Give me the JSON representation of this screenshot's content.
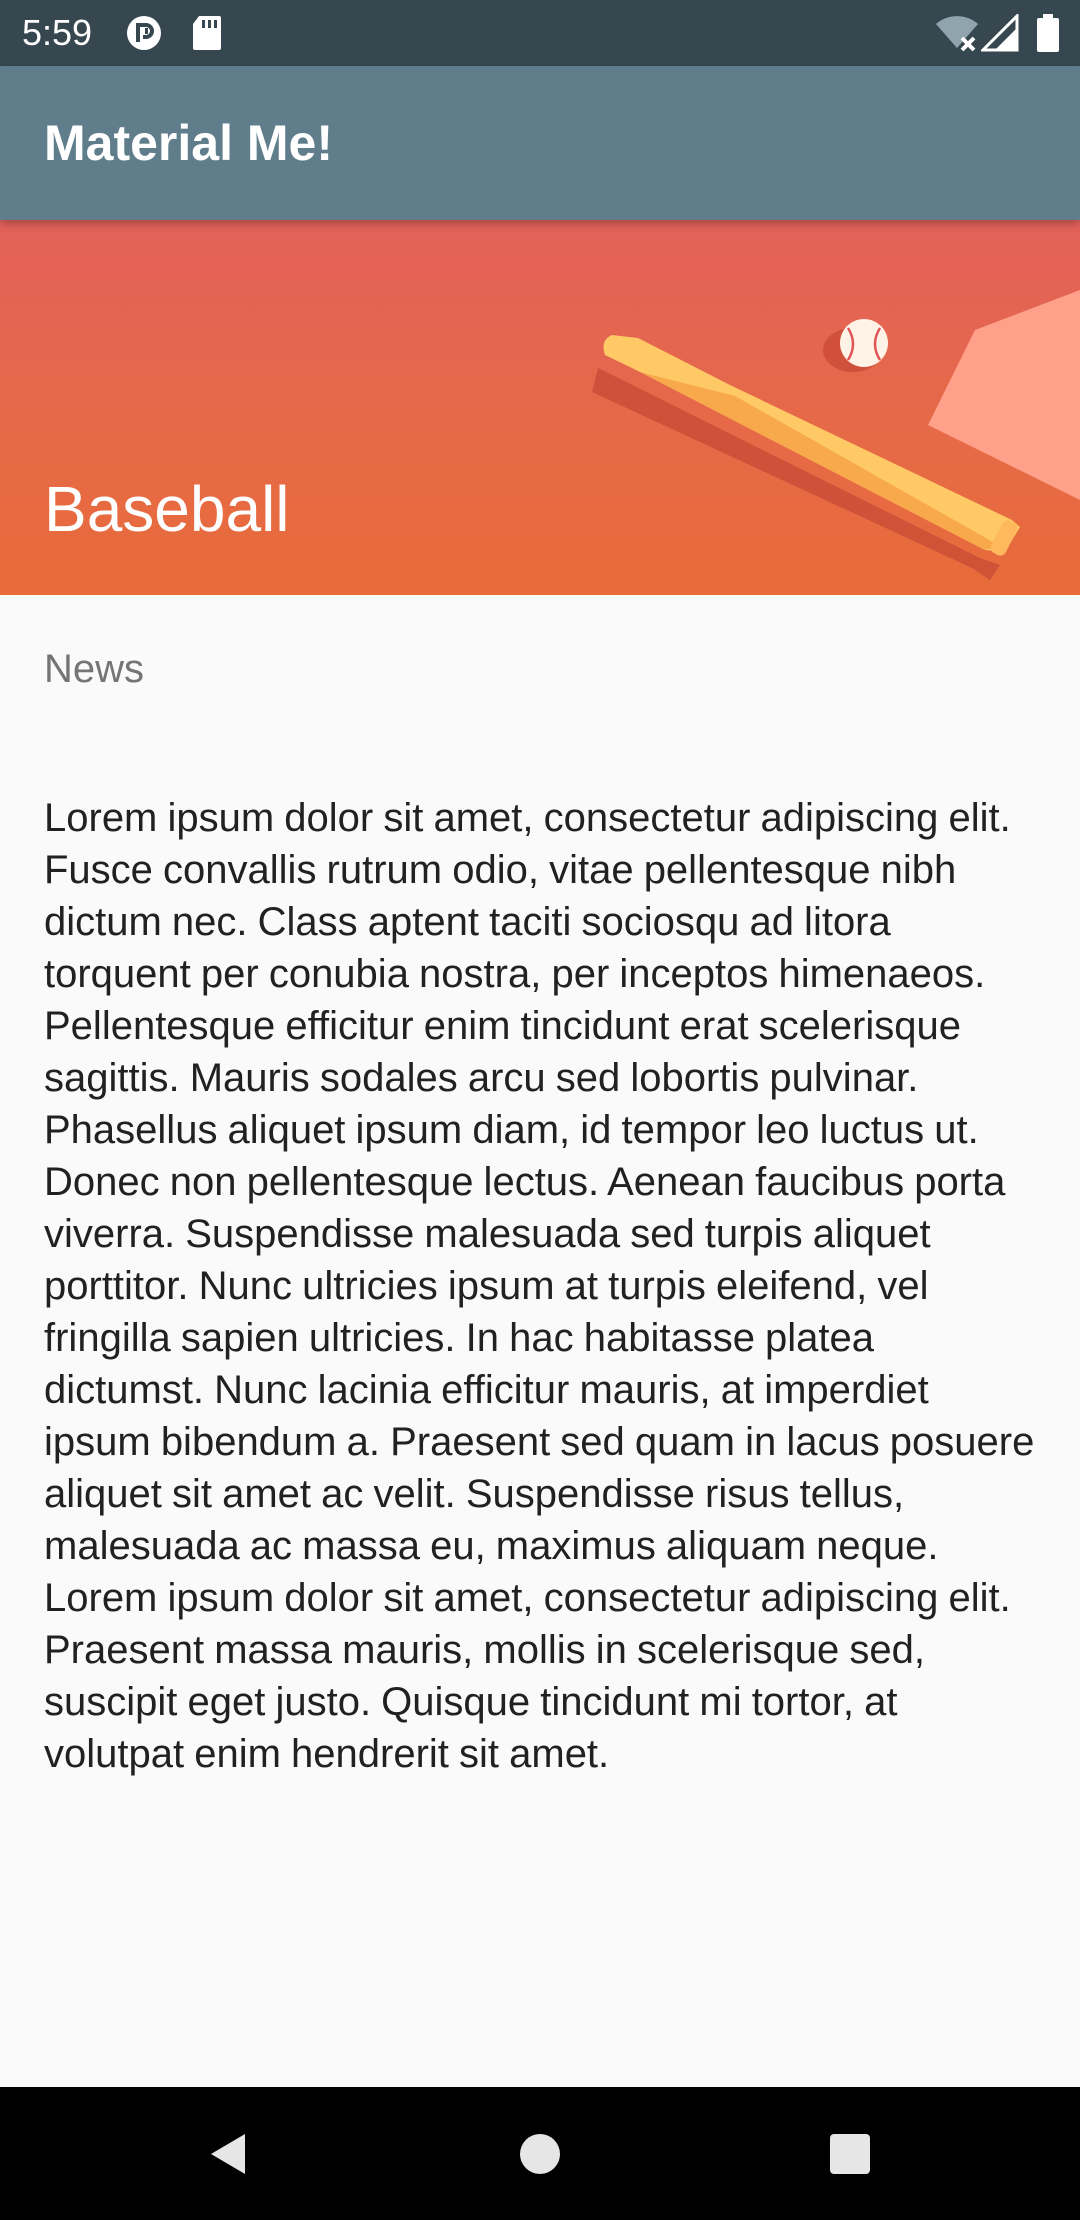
{
  "status_bar": {
    "time": "5:59",
    "left_icons": [
      "app-notification-icon",
      "sd-card-icon"
    ],
    "right_icons": [
      "wifi-off-icon",
      "cell-signal-icon",
      "battery-icon"
    ]
  },
  "app_bar": {
    "title": "Material Me!"
  },
  "header": {
    "title": "Baseball",
    "image": "baseball-header-image",
    "colors": {
      "top": "#e3615a",
      "bottom": "#e86b3a"
    }
  },
  "article": {
    "subtitle": "News",
    "body": "Lorem ipsum dolor sit amet, consectetur adipiscing elit. Fusce convallis rutrum odio, vitae pellentesque nibh dictum nec. Class aptent taciti sociosqu ad litora torquent per conubia nostra, per inceptos himenaeos. Pellentesque efficitur enim tincidunt erat scelerisque sagittis. Mauris sodales arcu sed lobortis pulvinar. Phasellus aliquet ipsum diam, id tempor leo luctus ut. Donec non pellentesque lectus. Aenean faucibus porta viverra. Suspendisse malesuada sed turpis aliquet porttitor. Nunc ultricies ipsum at turpis eleifend, vel fringilla sapien ultricies. In hac habitasse platea dictumst. Nunc lacinia efficitur mauris, at imperdiet ipsum bibendum a. Praesent sed quam in lacus posuere aliquet sit amet ac velit. Suspendisse risus tellus, malesuada ac massa eu, maximus aliquam neque. Lorem ipsum dolor sit amet, consectetur adipiscing elit. Praesent massa mauris, mollis in scelerisque sed, suscipit eget justo. Quisque tincidunt mi tortor, at volutpat enim hendrerit sit amet."
  },
  "nav_bar": {
    "buttons": [
      "back-icon",
      "home-icon",
      "recents-icon"
    ]
  },
  "colors": {
    "status_bar": "#37474f",
    "app_bar": "#607d8b",
    "background": "#fafafa",
    "subtitle_text": "#757575",
    "body_text": "#212121"
  }
}
